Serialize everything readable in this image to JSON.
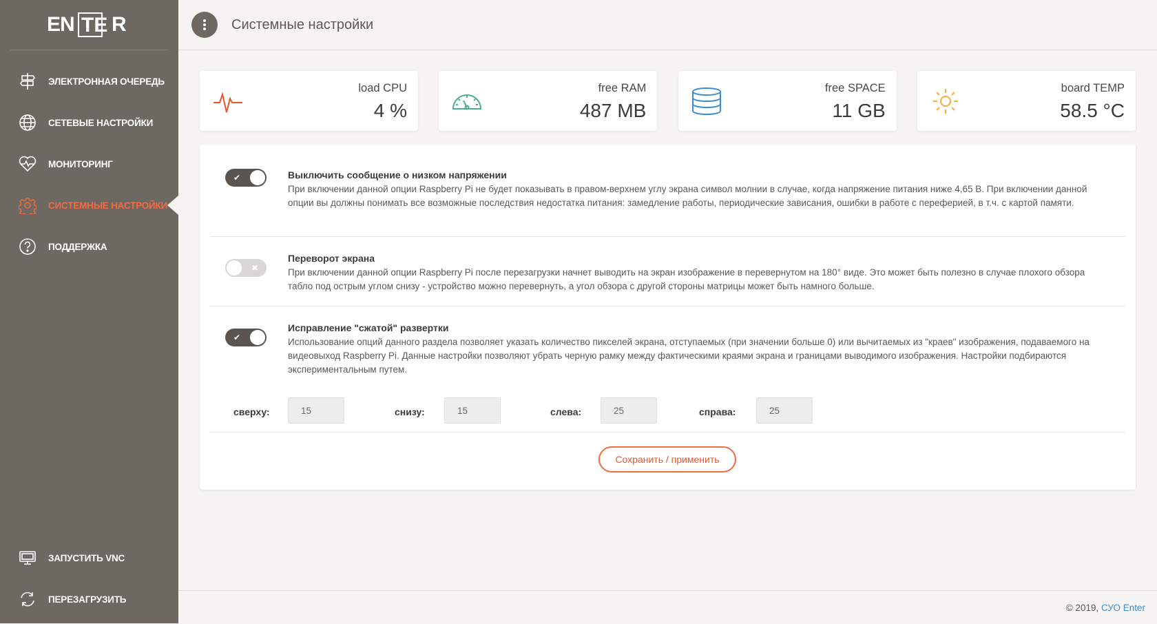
{
  "app": {
    "logo_text": "ENTER"
  },
  "sidebar": {
    "items": [
      {
        "label": "Электронная очередь",
        "icon": "signpost-icon"
      },
      {
        "label": "Сетевые настройки",
        "icon": "globe-icon"
      },
      {
        "label": "Мониторинг",
        "icon": "heart-pulse-icon"
      },
      {
        "label": "Системные настройки",
        "icon": "gear-icon",
        "active": true
      },
      {
        "label": "Поддержка",
        "icon": "question-icon"
      }
    ],
    "bottom_items": [
      {
        "label": "Запустить VNC",
        "icon": "monitor-icon"
      },
      {
        "label": "Перезагрузить",
        "icon": "refresh-icon"
      }
    ]
  },
  "header": {
    "title": "Системные настройки"
  },
  "stats": [
    {
      "label": "load CPU",
      "value": "4 %",
      "icon": "pulse-icon",
      "color": "#e8542a"
    },
    {
      "label": "free RAM",
      "value": "487 MB",
      "icon": "gauge-icon",
      "color": "#4caf8a"
    },
    {
      "label": "free SPACE",
      "value": "11 GB",
      "icon": "database-icon",
      "color": "#3a8dd0"
    },
    {
      "label": "board TEMP",
      "value": "58.5 °C",
      "icon": "sun-icon",
      "color": "#f2b134"
    }
  ],
  "settings": {
    "options": [
      {
        "enabled": true,
        "title": "Выключить сообщение о низком напряжении",
        "description": "При включении данной опции Raspberry Pi не будет показывать в правом-верхнем углу экрана символ молнии в случае, когда напряжение питания ниже 4,65 В. При включении данной опции вы должны понимать все возможные последствия недостатка питания: замедление работы, периодические зависания, ошибки в работе с переферией, в т.ч. с картой памяти."
      },
      {
        "enabled": false,
        "title": "Переворот экрана",
        "description": "При включении данной опции Raspberry Pi после перезагрузки начнет выводить на экран изображение в перевернутом на 180° виде. Это может быть полезно в случае плохого обзора табло под острым углом снизу - устройство можно перевернуть, а угол обзора с другой стороны матрицы может быть намного больше."
      },
      {
        "enabled": true,
        "title": "Исправление \"сжатой\" развертки",
        "description": "Использование опций данного раздела позволяет указать количество пикселей экрана, отступаемых (при значении больше 0) или вычитаемых из \"краев\" изображения, подаваемого на видеовыход Raspberry Pi. Данные настройки позволяют убрать черную рамку между фактическими краями экрана и границами выводимого изображения. Настройки подбираются экспериментальным путем."
      }
    ],
    "overscan": {
      "top": {
        "label": "сверху:",
        "value": "15"
      },
      "bottom": {
        "label": "снизу:",
        "value": "15"
      },
      "left": {
        "label": "слева:",
        "value": "25"
      },
      "right": {
        "label": "справа:",
        "value": "25"
      }
    },
    "save_label": "Сохранить / применить"
  },
  "footer": {
    "copyright": "© 2019,",
    "link_text": "СУО Enter"
  },
  "colors": {
    "sidebar": "#6e6862",
    "accent": "#f36a3f",
    "link": "#3a8dd0"
  }
}
